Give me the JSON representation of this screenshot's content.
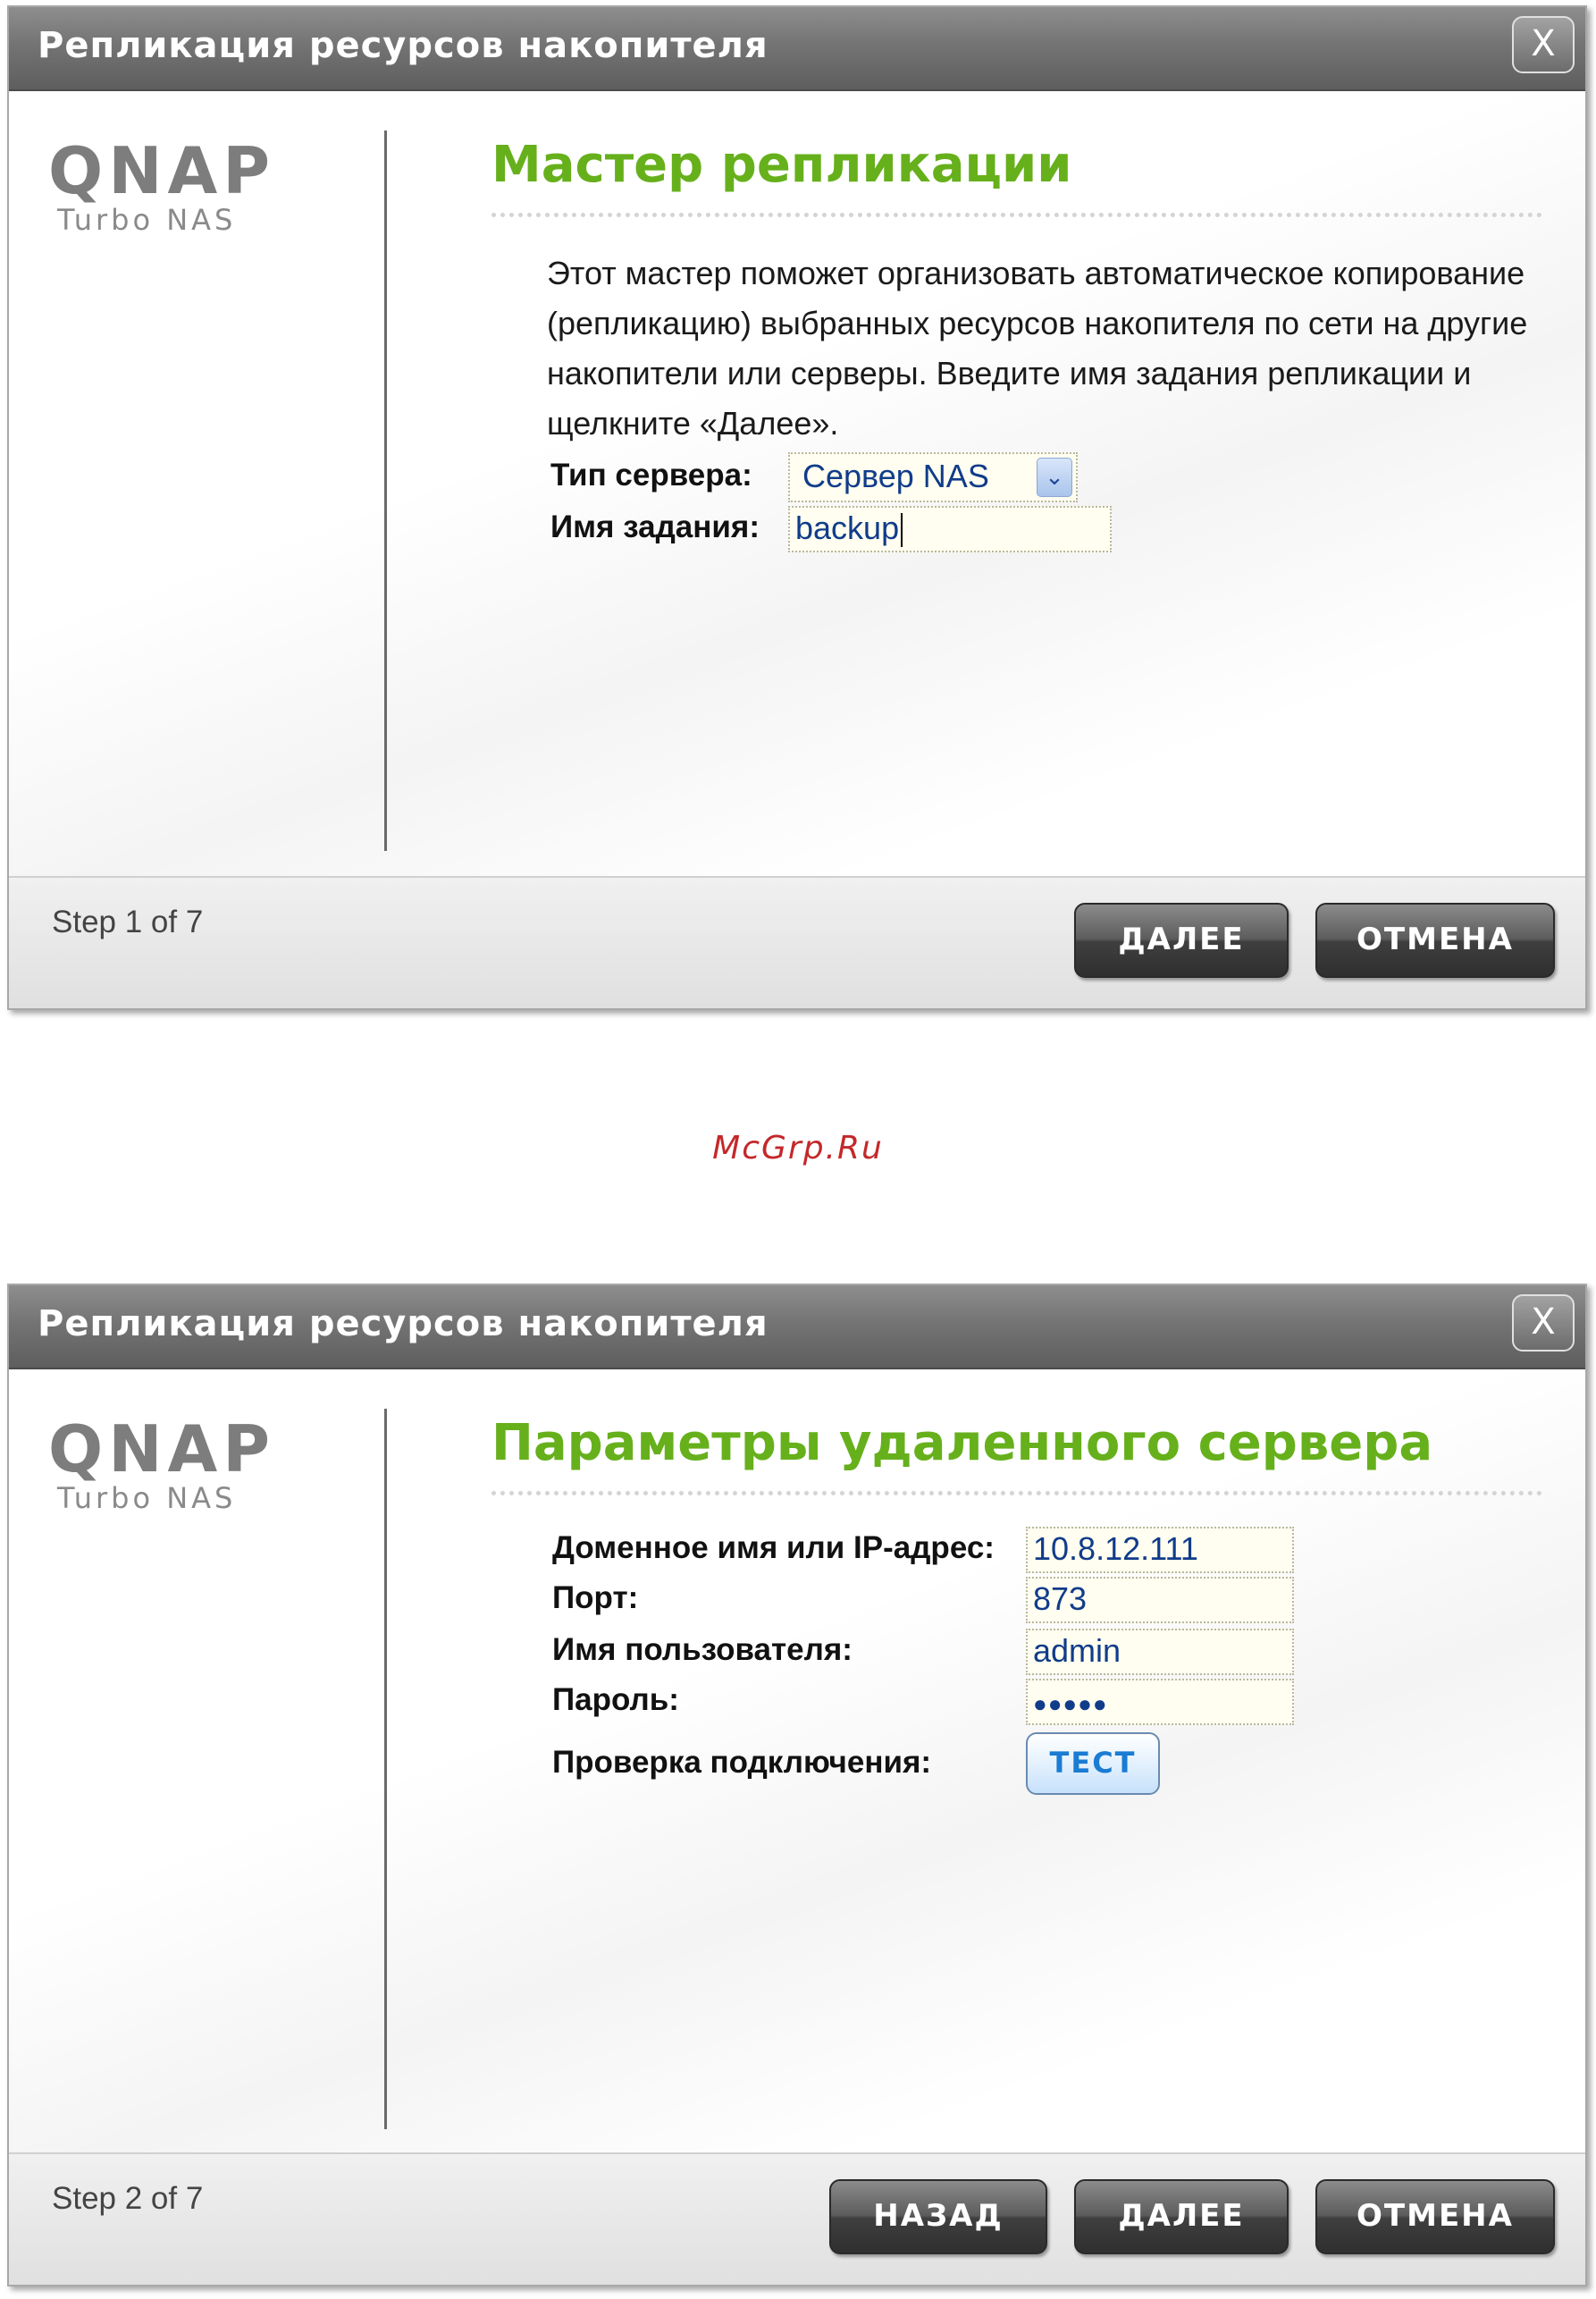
{
  "dialog1": {
    "title": "Репликация ресурсов накопителя",
    "close_label": "X",
    "logo_main": "QNAP",
    "logo_sub": "Turbo NAS",
    "heading": "Мастер репликации",
    "description": "Этот мастер поможет организовать автоматическое копирование (репликацию) выбранных ресурсов накопителя по сети на другие накопители или серверы.  Введите имя задания репликации и щелкните «Далее».",
    "server_type_label": "Тип сервера:",
    "server_type_value": "Сервер NAS",
    "job_name_label": "Имя задания:",
    "job_name_value": "backup",
    "step": "Step 1 of 7",
    "next_label": "ДАЛЕЕ",
    "cancel_label": "ОТМЕНА"
  },
  "watermark": "McGrp.Ru",
  "dialog2": {
    "title": "Репликация ресурсов накопителя",
    "close_label": "X",
    "logo_main": "QNAP",
    "logo_sub": "Turbo NAS",
    "heading": "Параметры удаленного сервера",
    "host_label": "Доменное имя или IP-адрес:",
    "host_value": "10.8.12.111",
    "port_label": "Порт:",
    "port_value": "873",
    "user_label": "Имя пользователя:",
    "user_value": "admin",
    "password_label": "Пароль:",
    "password_value": "●●●●●",
    "test_label": "Проверка подключения:",
    "test_button": "ТЕСТ",
    "step": "Step 2 of 7",
    "back_label": "НАЗАД",
    "next_label": "ДАЛЕЕ",
    "cancel_label": "ОТМЕНА"
  },
  "colors": {
    "heading_green": "#66b01c",
    "input_text_blue": "#103c8a",
    "watermark_red": "#c4282a",
    "titlebar_gray": "#747474"
  },
  "icons": {
    "close": "close-icon",
    "dropdown": "chevron-down-icon"
  }
}
